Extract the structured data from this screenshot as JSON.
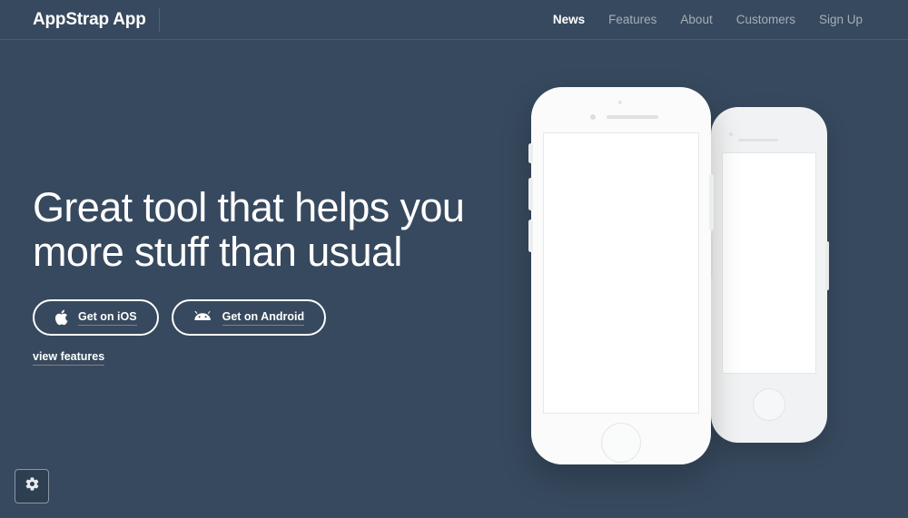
{
  "theme": {
    "background": "#37495e",
    "text_primary": "#ffffff",
    "text_muted": "#a6aeb8",
    "underline_accent": "#9a7580",
    "header_border": "#475c72",
    "phone_front": "#fbfbfc",
    "phone_back": "#f1f2f3"
  },
  "header": {
    "brand": "AppStrap App",
    "nav": [
      {
        "label": "News",
        "active": true
      },
      {
        "label": "Features",
        "active": false
      },
      {
        "label": "About",
        "active": false
      },
      {
        "label": "Customers",
        "active": false
      },
      {
        "label": "Sign Up",
        "active": false
      }
    ]
  },
  "hero": {
    "headline_line1": "Great tool that helps you",
    "headline_line2": "more stuff than usual",
    "buttons": [
      {
        "label": "Get on iOS",
        "icon": "apple-icon"
      },
      {
        "label": "Get on Android",
        "icon": "android-icon"
      }
    ],
    "link_label": "view features"
  },
  "mockup": {
    "front_device": "iphone-front",
    "back_device": "iphone-back"
  },
  "settings": {
    "icon": "gear-icon"
  }
}
